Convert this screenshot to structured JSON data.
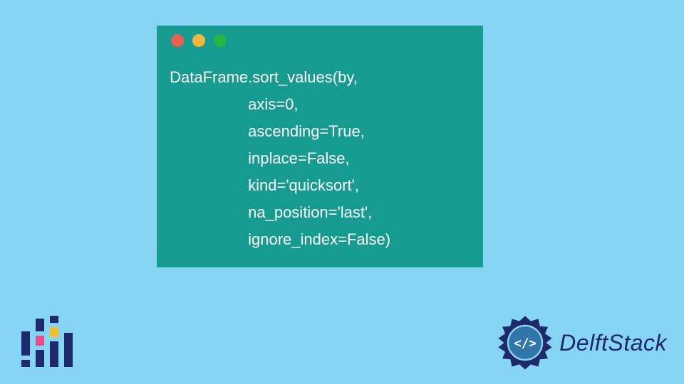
{
  "code_window": {
    "dot_colors": [
      "#ec5e4f",
      "#f3b63c",
      "#27b63f"
    ],
    "code_text": " DataFrame.sort_values(by,\n                   axis=0,\n                   ascending=True,\n                   inplace=False,\n                   kind='quicksort',\n                   na_position='last',\n                   ignore_index=False)"
  },
  "brand": {
    "name": "DelftStack"
  },
  "colors": {
    "background": "#87d5f5",
    "window": "#159b8f",
    "navy": "#1e2a6b",
    "logo_accent_pink": "#e94b8b",
    "logo_accent_yellow": "#f0c02d"
  }
}
